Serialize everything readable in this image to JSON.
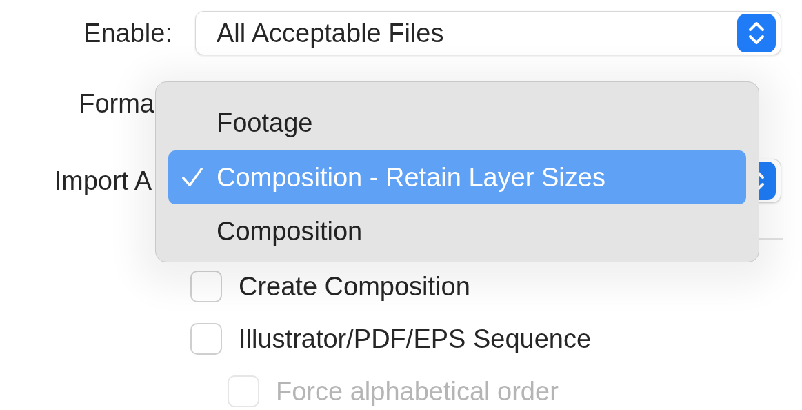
{
  "enable": {
    "label": "Enable:",
    "value": "All Acceptable Files"
  },
  "format": {
    "label": "Forma"
  },
  "import_as": {
    "label": "Import A"
  },
  "menu": {
    "items": [
      {
        "label": "Footage",
        "selected": false
      },
      {
        "label": "Composition - Retain Layer Sizes",
        "selected": true
      },
      {
        "label": "Composition",
        "selected": false
      }
    ]
  },
  "options": [
    {
      "label": "Create Composition",
      "checked": false,
      "disabled": false
    },
    {
      "label": "Illustrator/PDF/EPS Sequence",
      "checked": false,
      "disabled": false,
      "children": [
        {
          "label": "Force alphabetical order",
          "checked": false,
          "disabled": true
        }
      ]
    }
  ]
}
